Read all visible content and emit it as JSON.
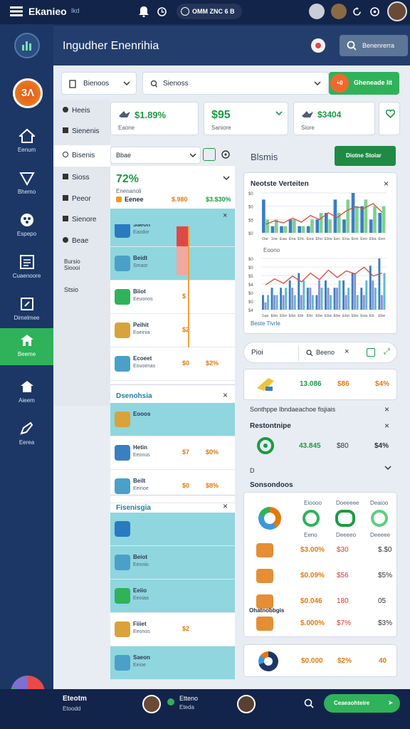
{
  "topbar": {
    "title": "Ekanieo",
    "subtitle": "lkd",
    "pill_text": "OMM ZNC 6 B"
  },
  "header": {
    "title": "Ingudher Enenrihia",
    "button_label": "Benenrerra"
  },
  "nav": {
    "badge": "3Λ",
    "items": [
      {
        "label": "Eenum",
        "icon": "home-icon"
      },
      {
        "label": "Bhemo",
        "icon": "send-icon"
      },
      {
        "label": "Espepo",
        "icon": "palette-icon"
      },
      {
        "label": "Cuaenoore",
        "icon": "document-icon"
      },
      {
        "label": "Dimelmee",
        "icon": "edit-icon"
      },
      {
        "label": "Beeme",
        "icon": "house-icon"
      },
      {
        "label": "Aieem",
        "icon": "home-outline-icon"
      },
      {
        "label": "Eerea",
        "icon": "pen-icon"
      }
    ]
  },
  "filters": {
    "select1": "Bienoos",
    "search": "Sienoss",
    "action": "Gheneade lit"
  },
  "side_menu": [
    {
      "label": "Heeis",
      "icon": "info-icon"
    },
    {
      "label": "Sienenis",
      "icon": "grid-icon"
    },
    {
      "label": "Bisenis",
      "icon": "circle-icon"
    },
    {
      "label": "Sioss",
      "icon": "grid-icon"
    },
    {
      "label": "Peeor",
      "icon": "grid-icon"
    },
    {
      "label": "Sienore",
      "icon": "grid-icon"
    },
    {
      "label": "Beae",
      "icon": "grid-icon"
    },
    {
      "label": "Bursio Sioooi",
      "icon": ""
    },
    {
      "label": "Stsio",
      "icon": ""
    }
  ],
  "kpis": [
    {
      "value": "$1.89%",
      "label": "Eaone",
      "icon": "bird-icon"
    },
    {
      "value": "$95",
      "label": "Saniore",
      "icon": "chevron-down-icon"
    },
    {
      "value": "$3404",
      "label": "Siore",
      "icon": "bird-icon"
    },
    {
      "value": "",
      "label": "",
      "icon": "heart-icon"
    }
  ],
  "toolbar2": {
    "select": "Bbae",
    "title": "Blsmis",
    "button": "Diotne Stoiar"
  },
  "list_summary": {
    "percent": "72%",
    "sub": "Enenanoli",
    "tag": "Eenee",
    "v1": "$.980",
    "v2": "$3.$30%"
  },
  "list_a": [
    {
      "t1": "Saeon",
      "t2": "Eaodor",
      "v1": "",
      "v2": "",
      "icon": "globe-icon",
      "bg": "teal"
    },
    {
      "t1": "Beidt",
      "t2": "Smaor",
      "v1": "$0",
      "v2": "",
      "icon": "doc-icon",
      "bg": "teal"
    },
    {
      "t1": "Biiot",
      "t2": "Eeuonos",
      "v1": "$",
      "v2": "",
      "icon": "bag-icon",
      "bg": "plain"
    },
    {
      "t1": "Peihit",
      "t2": "Eoeinia",
      "v1": "$2",
      "v2": "",
      "icon": "box-icon",
      "bg": "plain"
    },
    {
      "t1": "Ecoeet",
      "t2": "Eouoimas",
      "v1": "$0",
      "v2": "$2%",
      "icon": "doc-icon",
      "bg": "plain"
    }
  ],
  "list_b": {
    "title": "Dsenohsia",
    "rows": [
      {
        "t1": "Eooos",
        "t2": "",
        "v1": "",
        "v2": "",
        "icon": "box-icon",
        "bg": "teal"
      },
      {
        "t1": "Hetin",
        "t2": "Eeonus",
        "v1": "$7",
        "v2": "$0%",
        "icon": "house-icon",
        "bg": "plain"
      },
      {
        "t1": "Beilt",
        "t2": "Eeinoe",
        "v1": "$0",
        "v2": "$8%",
        "icon": "doc-icon",
        "bg": "plain"
      }
    ]
  },
  "list_c": {
    "title": "Fisenisgia",
    "rows": [
      {
        "t1": "",
        "t2": "",
        "v1": "",
        "v2": "",
        "icon": "globe-icon",
        "bg": "teal"
      },
      {
        "t1": "Beiot",
        "t2": "Eeonio",
        "v1": "",
        "v2": "",
        "icon": "doc-icon",
        "bg": "teal"
      },
      {
        "t1": "Eeiio",
        "t2": "Eeoiaa",
        "v1": "",
        "v2": "",
        "icon": "bag-icon",
        "bg": "teal"
      },
      {
        "t1": "Fiiiet",
        "t2": "Eeonos",
        "v1": "$2",
        "v2": "",
        "icon": "box-icon",
        "bg": "plain"
      },
      {
        "t1": "Saeon",
        "t2": "Eeioe",
        "v1": "",
        "v2": "",
        "icon": "doc-icon",
        "bg": "teal"
      }
    ]
  },
  "chart_card": {
    "title": "Neotste Verteiten",
    "legend": "Eoono",
    "footer": "Beste Tivrle"
  },
  "chart_data": [
    {
      "type": "bar",
      "title": "Neotste Verteiten",
      "ylabel": "",
      "yticks": [
        "$0",
        "$5",
        "$0",
        "$0"
      ],
      "categories": [
        "Oai",
        "1ne",
        "Eaa",
        "Ena",
        "Ehc",
        "Eea",
        "Eho",
        "Ebw",
        "Eec",
        "Ena",
        "Eroi",
        "Eeo",
        "Eba",
        "Eeo"
      ],
      "series": [
        {
          "color": "#3a7fc0",
          "values": [
            5,
            1,
            1,
            2,
            1,
            1,
            2,
            3,
            5,
            2,
            6,
            4,
            2,
            3
          ]
        },
        {
          "color": "#7fd18e",
          "values": [
            2,
            2,
            1,
            2,
            1,
            2,
            3,
            2,
            3,
            5,
            4,
            5,
            4,
            4
          ]
        }
      ],
      "line": [
        1.3,
        1.8,
        1.5,
        2.2,
        1.6,
        2.6,
        2.0,
        3.0,
        2.3,
        3.3,
        3.9,
        3.7,
        4.4,
        3.1
      ]
    },
    {
      "type": "bar",
      "title": "",
      "yticks": [
        "$4",
        "$0",
        "$0",
        "$4",
        "$5",
        "$0",
        "$0"
      ],
      "categories": [
        "1aa",
        "Ebo",
        "Ebo",
        "Ebo",
        "Ebi",
        "Ebi",
        "Ebe",
        "Eba",
        "Ebe",
        "Ebo",
        "Ebo",
        "Eea",
        "Eb",
        "Ebe"
      ],
      "series": [
        {
          "color": "#3a7fc0",
          "values": [
            2,
            3,
            3,
            4,
            5,
            3,
            2,
            4,
            3,
            4,
            5,
            3,
            6,
            7
          ]
        },
        {
          "color": "#8f8fd6",
          "values": [
            1,
            2,
            2,
            3,
            2,
            3,
            4,
            3,
            3,
            2,
            5,
            2,
            4,
            2
          ]
        },
        {
          "color": "#5fb9cc",
          "values": [
            2,
            2,
            3,
            2,
            4,
            2,
            3,
            2,
            4,
            3,
            2,
            4,
            3,
            5
          ]
        }
      ],
      "line": [
        3.4,
        4.2,
        3.6,
        4.6,
        3.8,
        5.0,
        4.1,
        5.4,
        4.4,
        5.3,
        4.9,
        5.8,
        4.6,
        5.0
      ]
    }
  ],
  "right_panel": {
    "pill": "Pioi",
    "search": "Beeno",
    "r1": {
      "v1": "13.086",
      "v2": "$86",
      "v3": "$4%"
    },
    "s1": "Sonthppe Ibndaeachoe fisjiais",
    "s2": "Restontnipe",
    "r2": {
      "v1": "43.845",
      "v2": "$80",
      "v3": "$4%"
    },
    "s3": "D",
    "s4": "Sonsondoos",
    "heads": [
      "Eioooo",
      "Doeeeee",
      "Deaioo"
    ],
    "ring_labels": [
      "Eeno",
      "Deeeeo",
      "Deeeee"
    ],
    "rows": [
      {
        "v1": "$3.00%",
        "v2": "$30",
        "v3": "$.$0",
        "label": ""
      },
      {
        "v1": "$0.09%",
        "v2": "$56",
        "v3": "$5%",
        "label": ""
      },
      {
        "v1": "$0.046",
        "v2": "180",
        "v3": "05",
        "label": "Ohatnobbgis"
      },
      {
        "v1": "$.000%",
        "v2": "$7%",
        "v3": "$3%",
        "label": ""
      }
    ],
    "last": {
      "v1": "$0.000",
      "v2": "$2%",
      "v3": "40"
    }
  },
  "bottom": {
    "title": "Eteotm",
    "sub": "Etoodd",
    "user": "Etteno",
    "user_sub": "Eteda",
    "button": "Ceaeaohteire"
  }
}
